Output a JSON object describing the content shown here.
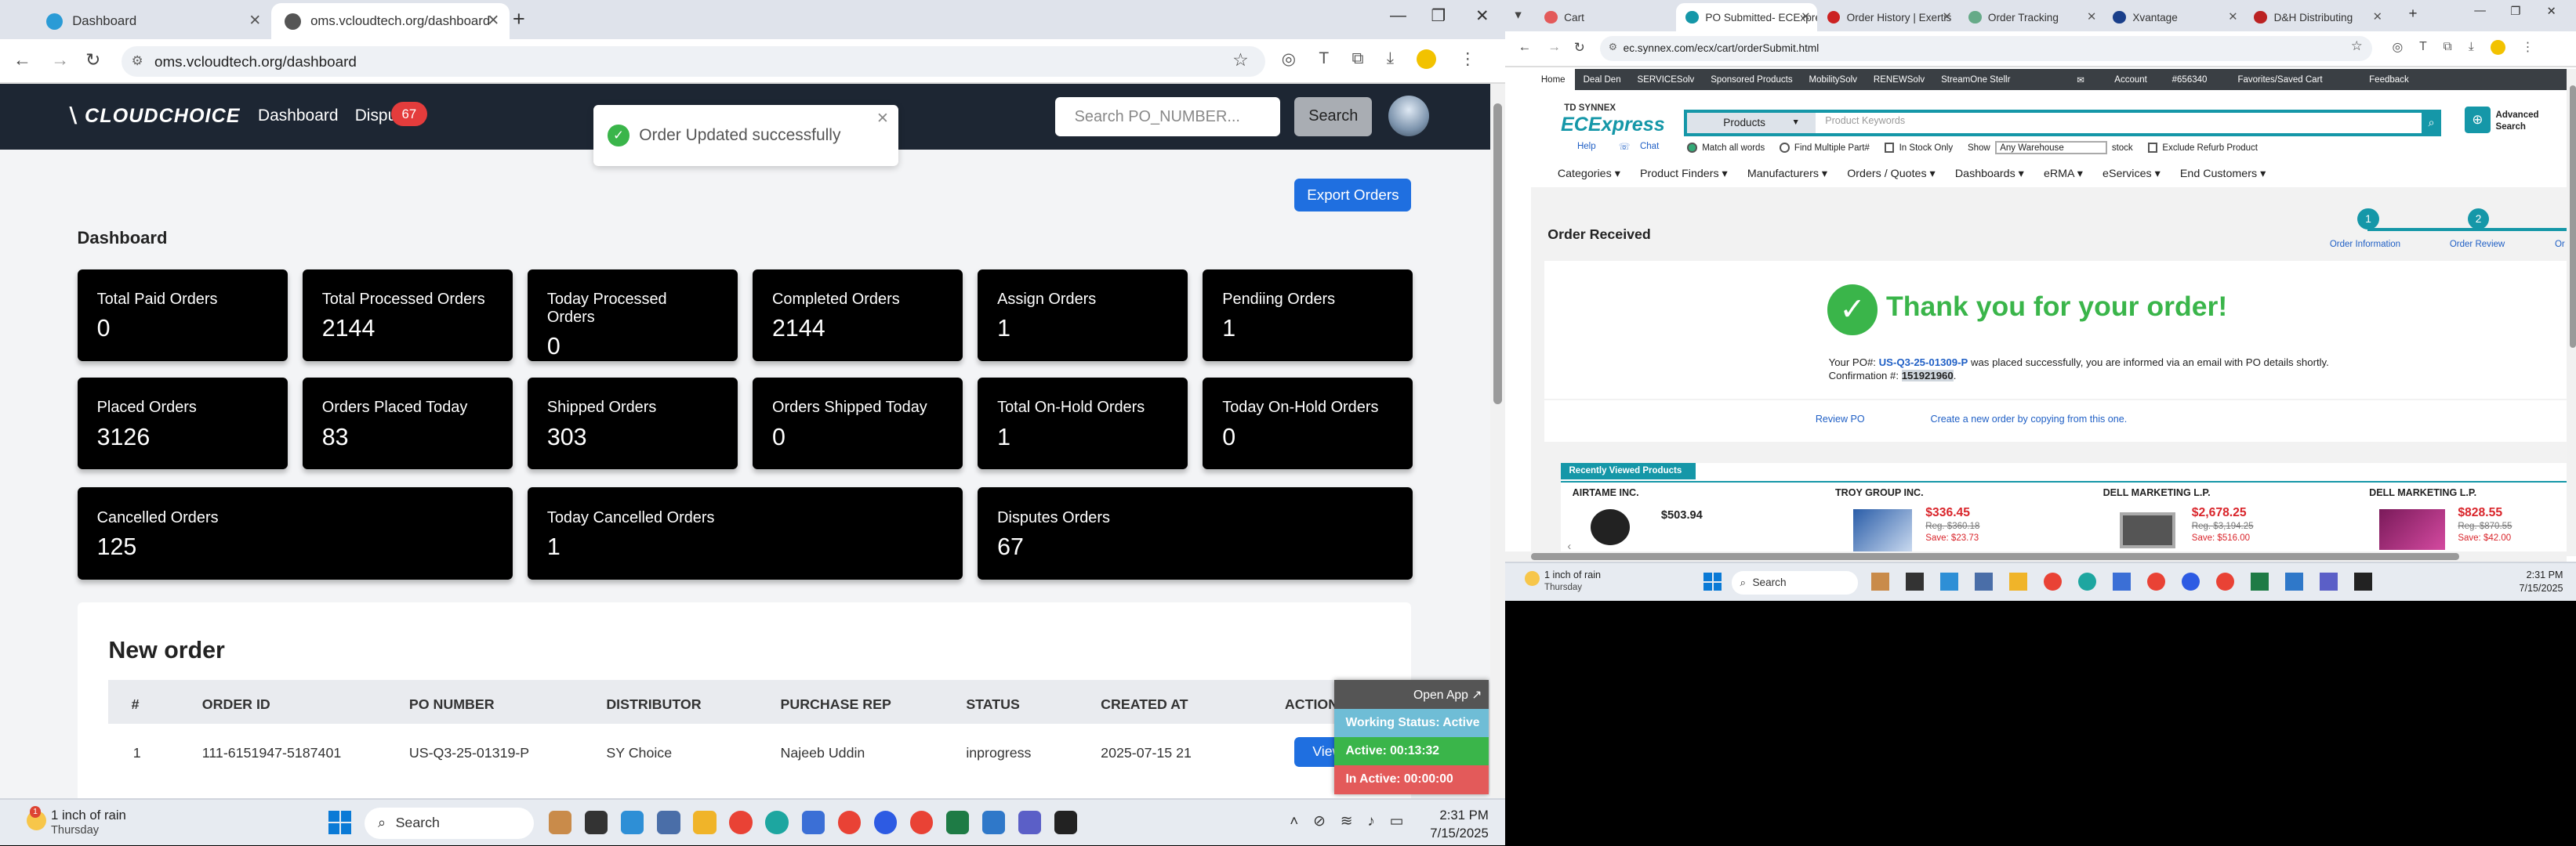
{
  "left_browser": {
    "tabs": [
      {
        "title": "Dashboard",
        "icon": "globe-icon"
      },
      {
        "title": "oms.vcloudtech.org/dashboard",
        "icon": "globe-icon"
      }
    ],
    "address": "oms.vcloudtech.org/dashboard",
    "app": {
      "brand": "CLOUDCHOICE",
      "nav": {
        "dashboard": "Dashboard",
        "disputes": "Dispu",
        "disputes_badge": "67"
      },
      "search_placeholder": "Search PO_NUMBER...",
      "search_button": "Search",
      "toast": "Order Updated successfully",
      "export_button": "Export Orders",
      "section_title": "Dashboard",
      "stats": [
        {
          "label": "Total Paid Orders",
          "value": "0"
        },
        {
          "label": "Total Processed Orders",
          "value": "2144"
        },
        {
          "label": "Today Processed Orders",
          "value": "0"
        },
        {
          "label": "Completed Orders",
          "value": "2144"
        },
        {
          "label": "Assign Orders",
          "value": "1"
        },
        {
          "label": "Pendiing Orders",
          "value": "1"
        },
        {
          "label": "Placed Orders",
          "value": "3126"
        },
        {
          "label": "Orders Placed Today",
          "value": "83"
        },
        {
          "label": "Shipped Orders",
          "value": "303"
        },
        {
          "label": "Orders Shipped Today",
          "value": "0"
        },
        {
          "label": "Total On-Hold Orders",
          "value": "1"
        },
        {
          "label": "Today On-Hold Orders",
          "value": "0"
        },
        {
          "label": "Cancelled Orders",
          "value": "125"
        },
        {
          "label": "Today Cancelled Orders",
          "value": "1"
        },
        {
          "label": "Disputes Orders",
          "value": "67"
        }
      ],
      "new_order": {
        "title": "New order",
        "headers": [
          "#",
          "ORDER ID",
          "PO NUMBER",
          "DISTRIBUTOR",
          "PURCHASE REP",
          "STATUS",
          "CREATED AT",
          "ACTION"
        ],
        "rows": [
          {
            "num": "1",
            "order_id": "111-6151947-5187401",
            "po": "US-Q3-25-01319-P",
            "distributor": "SY Choice",
            "rep": "Najeeb Uddin",
            "status": "inprogress",
            "created": "2025-07-15 21",
            "action": "View"
          }
        ]
      },
      "widget": {
        "open_app": "Open App ↗",
        "status": "Working Status: Active",
        "active": "Active: 00:13:32",
        "inactive": "In Active: 00:00:00"
      }
    },
    "taskbar": {
      "weather": "1 inch of rain",
      "weather_sub": "Thursday",
      "weather_badge": "1",
      "search": "Search",
      "time": "2:31 PM",
      "date": "7/15/2025"
    }
  },
  "right_browser": {
    "tabs": [
      {
        "title": "Cart"
      },
      {
        "title": "PO Submitted- ECExpress"
      },
      {
        "title": "Order History | Exertis"
      },
      {
        "title": "Order Tracking"
      },
      {
        "title": "Xvantage"
      },
      {
        "title": "D&H Distributing"
      }
    ],
    "address": "ec.synnex.com/ecx/cart/orderSubmit.html",
    "topnav": {
      "items": [
        "Home",
        "Deal Den",
        "SERVICESolv",
        "Sponsored Products",
        "MobilitySolv",
        "RENEWSolv",
        "StreamOne Stellr"
      ],
      "account": "Account",
      "account_no": "#656340",
      "favorites": "Favorites/Saved Cart",
      "feedback": "Feedback"
    },
    "logo": {
      "top": "TD SYNNEX",
      "main": "ECExpress"
    },
    "search": {
      "category": "Products",
      "placeholder": "Product Keywords",
      "advanced": "Advanced Search"
    },
    "options": {
      "help": "Help",
      "chat": "Chat",
      "match": "Match all words",
      "multiple": "Find Multiple Part#",
      "instock": "In Stock Only",
      "show": "Show",
      "warehouse": "Any Warehouse",
      "stock": "stock",
      "exclude": "Exclude Refurb Product"
    },
    "categories": [
      "Categories",
      "Product Finders",
      "Manufacturers",
      "Orders / Quotes",
      "Dashboards",
      "eRMA",
      "eServices",
      "End Customers"
    ],
    "order": {
      "title": "Order Received",
      "steps": [
        {
          "num": "1",
          "label": "Order Information"
        },
        {
          "num": "2",
          "label": "Order Review"
        },
        {
          "num": "",
          "label": "Or"
        }
      ],
      "thanks": "Thank you for your order!",
      "po_prefix": "Your PO#:",
      "po": "US-Q3-25-01309-P",
      "po_suffix": "was placed successfully, you are informed via an email with PO details shortly. Confirmation #:",
      "confirmation": "151921960",
      "review": "Review PO",
      "create": "Create a new order by copying from this one."
    },
    "recent": {
      "title": "Recently Viewed Products",
      "products": [
        {
          "brand": "AIRTAME INC.",
          "price": "$503.94",
          "reg": "",
          "save": ""
        },
        {
          "brand": "TROY GROUP INC.",
          "price": "$336.45",
          "reg": "Reg. $360.18",
          "save": "Save: $23.73"
        },
        {
          "brand": "DELL MARKETING L.P.",
          "price": "$2,678.25",
          "reg": "Reg. $3,194.25",
          "save": "Save: $516.00"
        },
        {
          "brand": "DELL MARKETING L.P.",
          "price": "$828.55",
          "reg": "Reg. $870.55",
          "save": "Save: $42.00"
        }
      ]
    },
    "taskbar": {
      "weather": "1 inch of rain",
      "weather_sub": "Thursday",
      "search": "Search",
      "time": "2:31 PM",
      "date": "7/15/2025"
    }
  },
  "colors": {
    "nav": "#1d2633",
    "primary": "#1f6fe0",
    "success": "#3ab54a",
    "synnex_teal": "#1597a8",
    "widget_active": "#3ab54a",
    "widget_inactive": "#e35a5a"
  }
}
